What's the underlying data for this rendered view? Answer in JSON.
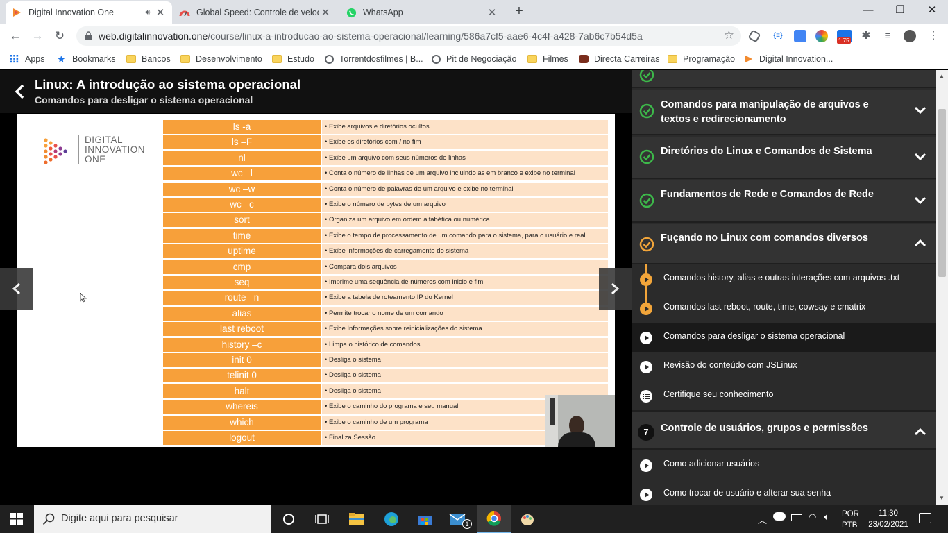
{
  "browser": {
    "tabs": [
      {
        "title": "Digital Innovation One",
        "active": true,
        "audio": true
      },
      {
        "title": "Global Speed: Controle de veloci",
        "active": false
      },
      {
        "title": "WhatsApp",
        "active": false
      }
    ],
    "new_tab": "+",
    "window_controls": {
      "minimize": "—",
      "maximize": "❐",
      "close": "✕"
    },
    "url_host": "web.digitalinnovation.one",
    "url_path": "/course/linux-a-introducao-ao-sistema-operacional/learning/586a7cf5-aae6-4c4f-a428-7ab6c7b54d5a",
    "extension_badge": "1.75",
    "bookmarks": [
      {
        "label": "Apps",
        "icon": "apps-grid-icon"
      },
      {
        "label": "Bookmarks",
        "icon": "star-icon"
      },
      {
        "label": "Bancos",
        "icon": "folder-icon"
      },
      {
        "label": "Desenvolvimento",
        "icon": "folder-icon"
      },
      {
        "label": "Estudo",
        "icon": "folder-icon"
      },
      {
        "label": "Torrentdosfilmes | B...",
        "icon": "globe-icon"
      },
      {
        "label": "Pit de Negociação",
        "icon": "globe-icon"
      },
      {
        "label": "Filmes",
        "icon": "folder-icon"
      },
      {
        "label": "Directa Carreiras",
        "icon": "site-icon"
      },
      {
        "label": "Programação",
        "icon": "folder-icon"
      },
      {
        "label": "Digital Innovation...",
        "icon": "dio-icon"
      }
    ]
  },
  "course": {
    "title": "Linux: A introdução ao sistema operacional",
    "lesson": "Comandos para desligar o sistema operacional"
  },
  "slide": {
    "logo_text": [
      "DIGITAL",
      "INNOVATION",
      "ONE"
    ],
    "commands": [
      {
        "cmd": "ls -a",
        "desc": "• Exibe arquivos e diretórios ocultos"
      },
      {
        "cmd": "ls –F",
        "desc": "• Exibe os diretórios com / no fim"
      },
      {
        "cmd": "nl",
        "desc": "• Exibe um arquivo com seus números de linhas"
      },
      {
        "cmd": "wc –l",
        "desc": "• Conta o número de linhas de um arquivo incluindo as em branco e exibe no terminal"
      },
      {
        "cmd": "wc –w",
        "desc": "• Conta o número de palavras de um arquivo e exibe no terminal"
      },
      {
        "cmd": "wc –c",
        "desc": "• Exibe o número de bytes de um arquivo"
      },
      {
        "cmd": "sort",
        "desc": "• Organiza um arquivo em ordem alfabética ou numérica"
      },
      {
        "cmd": "time",
        "desc": "• Exibe o tempo de processamento de um comando para o sistema, para o usuário e real"
      },
      {
        "cmd": "uptime",
        "desc": "• Exibe informações de carregamento do sistema"
      },
      {
        "cmd": "cmp",
        "desc": "• Compara dois arquivos"
      },
      {
        "cmd": "seq",
        "desc": "• Imprime uma sequência de números com inicio e fim"
      },
      {
        "cmd": "route –n",
        "desc": "• Exibe a tabela de roteamento IP do Kernel"
      },
      {
        "cmd": "alias",
        "desc": "• Permite trocar o nome de um comando"
      },
      {
        "cmd": "last reboot",
        "desc": "• Exibe Informações sobre reinicializações do sistema"
      },
      {
        "cmd": "history –c",
        "desc": "• Limpa o histórico de comandos"
      },
      {
        "cmd": "init 0",
        "desc": "• Desliga o sistema"
      },
      {
        "cmd": "telinit 0",
        "desc": "• Desliga o sistema"
      },
      {
        "cmd": "halt",
        "desc": "• Desliga o sistema"
      },
      {
        "cmd": "whereis",
        "desc": "• Exibe o caminho do programa e seu manual"
      },
      {
        "cmd": "which",
        "desc": "• Exibe o caminho de um programa"
      },
      {
        "cmd": "logout",
        "desc": "• Finaliza Sessão"
      }
    ]
  },
  "sidebar": {
    "sections": [
      {
        "title": "Comandos para manipulação de arquivos e textos e redirecionamento",
        "status": "complete",
        "expanded": false
      },
      {
        "title": "Diretórios do Linux e Comandos de Sistema",
        "status": "complete",
        "expanded": false
      },
      {
        "title": "Fundamentos de Rede e Comandos de Rede",
        "status": "complete",
        "expanded": false
      },
      {
        "title": "Fuçando no Linux com comandos diversos",
        "status": "in-progress",
        "expanded": true
      },
      {
        "title": "Controle de usuários, grupos e permissões",
        "number": "7",
        "expanded": true
      }
    ],
    "lessons_section4": [
      {
        "title": "Comandos history, alias e outras interações com arquivos .txt",
        "state": "watched"
      },
      {
        "title": "Comandos last reboot, route, time, cowsay e cmatrix",
        "state": "watched"
      },
      {
        "title": "Comandos para desligar o sistema operacional",
        "state": "current"
      },
      {
        "title": "Revisão do conteúdo com JSLinux",
        "state": "pending"
      },
      {
        "title": "Certifique seu conhecimento",
        "state": "quiz"
      }
    ],
    "lessons_section7": [
      {
        "title": "Como adicionar usuários",
        "state": "pending"
      },
      {
        "title": "Como trocar de usuário e alterar sua senha",
        "state": "pending"
      }
    ]
  },
  "taskbar": {
    "search_placeholder": "Digite aqui para pesquisar",
    "mail_badge": "1",
    "language": "POR",
    "keyboard": "PTB",
    "time": "11:30",
    "date": "23/02/2021"
  },
  "colors": {
    "accent": "#f2a53a",
    "complete": "#3db84a",
    "sidebar_bg": "#2b2b2b"
  }
}
